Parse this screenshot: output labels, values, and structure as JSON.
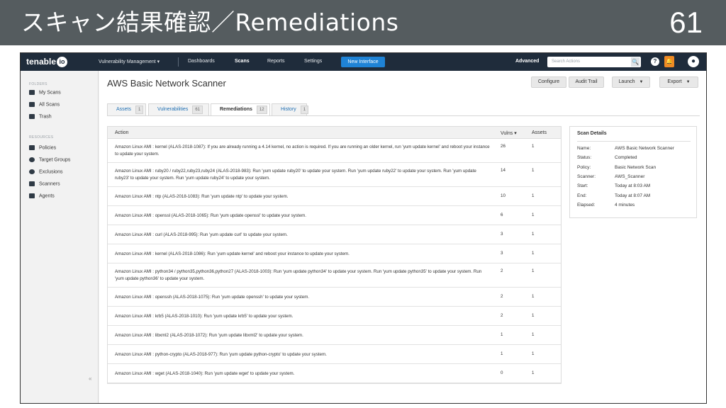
{
  "slide": {
    "title": "スキャン結果確認／Remediations",
    "page_number": "61"
  },
  "topnav": {
    "logo": "tenable",
    "logo_suffix": "io",
    "product": "Vulnerability Management ▾",
    "items": [
      "Dashboards",
      "Scans",
      "Reports",
      "Settings"
    ],
    "new_interface": "New Interface",
    "advanced": "Advanced",
    "search_placeholder": "Search Actions",
    "search_icon": "🔍",
    "help": "?",
    "bell": "🔔",
    "user": "●"
  },
  "sidebar": {
    "folders_label": "FOLDERS",
    "folders": [
      "My Scans",
      "All Scans",
      "Trash"
    ],
    "resources_label": "RESOURCES",
    "resources": [
      "Policies",
      "Target Groups",
      "Exclusions",
      "Scanners",
      "Agents"
    ],
    "collapse": "«"
  },
  "main": {
    "title": "AWS Basic Network Scanner",
    "buttons": {
      "configure": "Configure",
      "audit_trail": "Audit Trail",
      "launch": "Launch",
      "export": "Export"
    },
    "tabs": [
      {
        "label": "Assets",
        "count": "1"
      },
      {
        "label": "Vulnerabilities",
        "count": "61"
      },
      {
        "label": "Remediations",
        "count": "12"
      },
      {
        "label": "History",
        "count": "1"
      }
    ],
    "table": {
      "headers": {
        "action": "Action",
        "vulns": "Vulns ▾",
        "assets": "Assets"
      },
      "rows": [
        {
          "action": "Amazon Linux AMI : kernel (ALAS-2018-1087): If you are already running a 4.14 kernel, no action is required. If you are running an older kernel, run 'yum update kernel' and reboot your instance to update your system.",
          "vulns": "26",
          "assets": "1"
        },
        {
          "action": "Amazon Linux AMI : ruby20 / ruby22,ruby23,ruby24 (ALAS-2018-983): Run 'yum update ruby20' to update your system. Run 'yum update ruby22' to update your system. Run 'yum update ruby23' to update your system. Run 'yum update ruby24' to update your system.",
          "vulns": "14",
          "assets": "1"
        },
        {
          "action": "Amazon Linux AMI : ntp (ALAS-2018-1083): Run 'yum update ntp' to update your system.",
          "vulns": "10",
          "assets": "1"
        },
        {
          "action": "Amazon Linux AMI : openssl (ALAS-2018-1065): Run 'yum update openssl' to update your system.",
          "vulns": "6",
          "assets": "1"
        },
        {
          "action": "Amazon Linux AMI : curl (ALAS-2018-995): Run 'yum update curl' to update your system.",
          "vulns": "3",
          "assets": "1"
        },
        {
          "action": "Amazon Linux AMI : kernel (ALAS-2018-1086): Run 'yum update kernel' and reboot your instance to update your system.",
          "vulns": "3",
          "assets": "1"
        },
        {
          "action": "Amazon Linux AMI : python34 / python35,python36,python27 (ALAS-2018-1003): Run 'yum update python34' to update your system. Run 'yum update python35' to update your system. Run 'yum update python36' to update your system.",
          "vulns": "2",
          "assets": "1"
        },
        {
          "action": "Amazon Linux AMI : openssh (ALAS-2018-1075): Run 'yum update openssh' to update your system.",
          "vulns": "2",
          "assets": "1"
        },
        {
          "action": "Amazon Linux AMI : krb5 (ALAS-2018-1010): Run 'yum update krb5' to update your system.",
          "vulns": "2",
          "assets": "1"
        },
        {
          "action": "Amazon Linux AMI : libxml2 (ALAS-2018-1072): Run 'yum update libxml2' to update your system.",
          "vulns": "1",
          "assets": "1"
        },
        {
          "action": "Amazon Linux AMI : python-crypto (ALAS-2018-977): Run 'yum update python-crypto' to update your system.",
          "vulns": "1",
          "assets": "1"
        },
        {
          "action": "Amazon Linux AMI : wget (ALAS-2018-1040): Run 'yum update wget' to update your system.",
          "vulns": "0",
          "assets": "1"
        }
      ]
    },
    "details": {
      "title": "Scan Details",
      "fields": [
        {
          "label": "Name:",
          "value": "AWS Basic Network Scanner"
        },
        {
          "label": "Status:",
          "value": "Completed"
        },
        {
          "label": "Policy:",
          "value": "Basic Network Scan"
        },
        {
          "label": "Scanner:",
          "value": "AWS_Scanner"
        },
        {
          "label": "Start:",
          "value": "Today at 8:03 AM"
        },
        {
          "label": "End:",
          "value": "Today at 8:07 AM"
        },
        {
          "label": "Elapsed:",
          "value": "4 minutes"
        }
      ]
    }
  }
}
